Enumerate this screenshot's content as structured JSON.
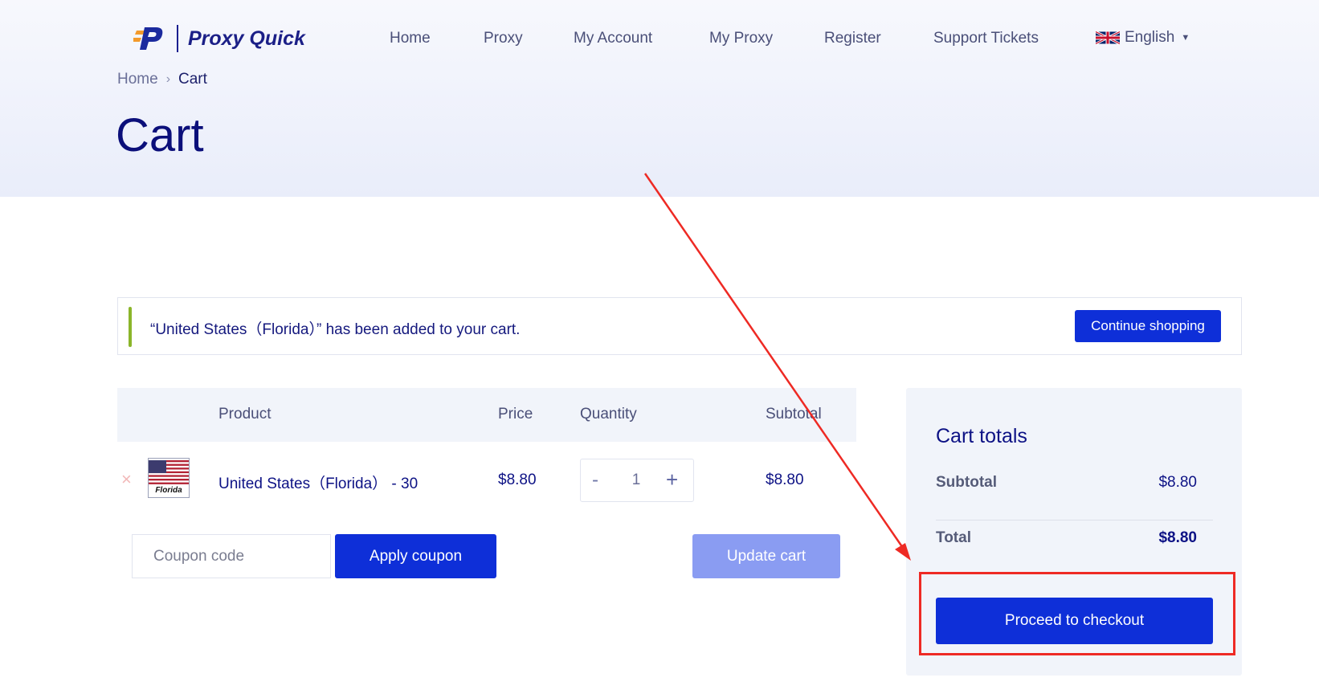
{
  "brand": {
    "name": "Proxy Quick"
  },
  "nav": {
    "items": [
      "Home",
      "Proxy",
      "My Account",
      "My Proxy",
      "Register",
      "Support Tickets"
    ],
    "language": "English"
  },
  "breadcrumb": {
    "home": "Home",
    "separator": "›",
    "current": "Cart"
  },
  "page": {
    "title": "Cart"
  },
  "notice": {
    "message": "“United States（Florida）” has been added to your cart.",
    "continue_label": "Continue shopping"
  },
  "cart_table": {
    "headers": {
      "product": "Product",
      "price": "Price",
      "quantity": "Quantity",
      "subtotal": "Subtotal"
    },
    "rows": [
      {
        "remove": "×",
        "thumb_label": "Florida",
        "product": "United States（Florida） - 30",
        "price": "$8.80",
        "quantity": "1",
        "subtotal": "$8.80"
      }
    ],
    "qty_minus": "-",
    "qty_plus": "+"
  },
  "actions": {
    "coupon_placeholder": "Coupon code",
    "apply_label": "Apply coupon",
    "update_label": "Update cart"
  },
  "totals": {
    "title": "Cart totals",
    "subtotal_label": "Subtotal",
    "subtotal_value": "$8.80",
    "total_label": "Total",
    "total_value": "$8.80",
    "checkout_label": "Proceed to checkout"
  },
  "colors": {
    "primary": "#0e2fd8",
    "heading": "#0b0f7a",
    "annotation": "#ee2a24",
    "notice_accent": "#8bb52a"
  }
}
